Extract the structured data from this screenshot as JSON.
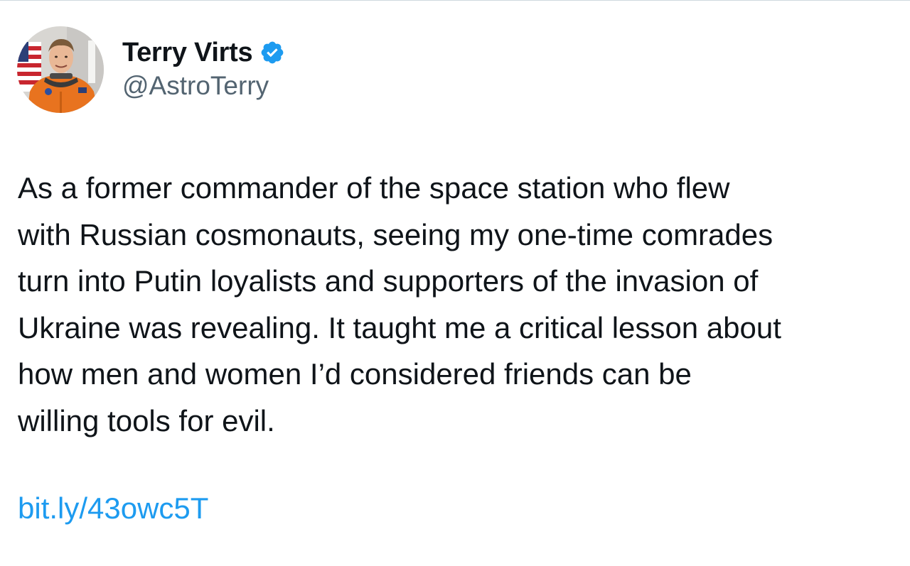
{
  "author": {
    "display_name": "Terry Virts",
    "handle": "@AstroTerry",
    "avatar_icon": "astronaut-avatar",
    "verified_icon": "verified-badge-icon",
    "verified_color": "#1d9bf0"
  },
  "tweet": {
    "lines": [
      "As a former commander of the space station who flew",
      "with Russian cosmonauts, seeing my one-time comrades",
      "turn into Putin loyalists and supporters of the invasion of",
      "Ukraine was revealing. It taught me a critical lesson about",
      "how men and women I’d considered friends can be",
      "willing tools for evil."
    ],
    "link": "bit.ly/43owc5T"
  },
  "colors": {
    "text": "#0f1419",
    "secondary": "#536471",
    "link": "#1d9bf0"
  }
}
